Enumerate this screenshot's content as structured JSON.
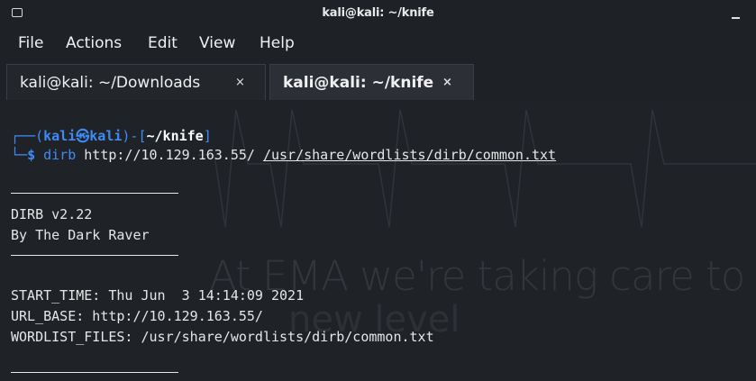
{
  "window": {
    "title": "kali@kali: ~/knife"
  },
  "menu": {
    "file": "File",
    "actions": "Actions",
    "edit": "Edit",
    "view": "View",
    "help": "Help"
  },
  "tabs": [
    {
      "label": "kali@kali: ~/Downloads",
      "close": "×",
      "active": false
    },
    {
      "label": "kali@kali: ~/knife",
      "close": "×",
      "active": true
    }
  ],
  "prompt": {
    "open_bracket": "┌──(",
    "user": "kali",
    "at_symbol": "㉿",
    "host": "kali",
    "mid": ")-[",
    "path": "~/knife",
    "close_bracket": "]",
    "corner": "└─",
    "dollar": "$",
    "command": "dirb",
    "arg_url": "http://10.129.163.55/",
    "arg_wordlist": "/usr/share/wordlists/dirb/common.txt"
  },
  "output": {
    "version": "DIRB v2.22",
    "author": "By The Dark Raver",
    "start_time": "START_TIME: Thu Jun  3 14:14:09 2021",
    "url_base": "URL_BASE: http://10.129.163.55/",
    "wordlist_files": "WORDLIST_FILES: /usr/share/wordlists/dirb/common.txt"
  },
  "wallpaper": {
    "line1": "At EMA we're taking care to",
    "line2": "new level"
  },
  "colors": {
    "prompt_blue": "#3f8bf5",
    "terminal_bg": "#1f2328",
    "text": "#e6e6e6"
  }
}
